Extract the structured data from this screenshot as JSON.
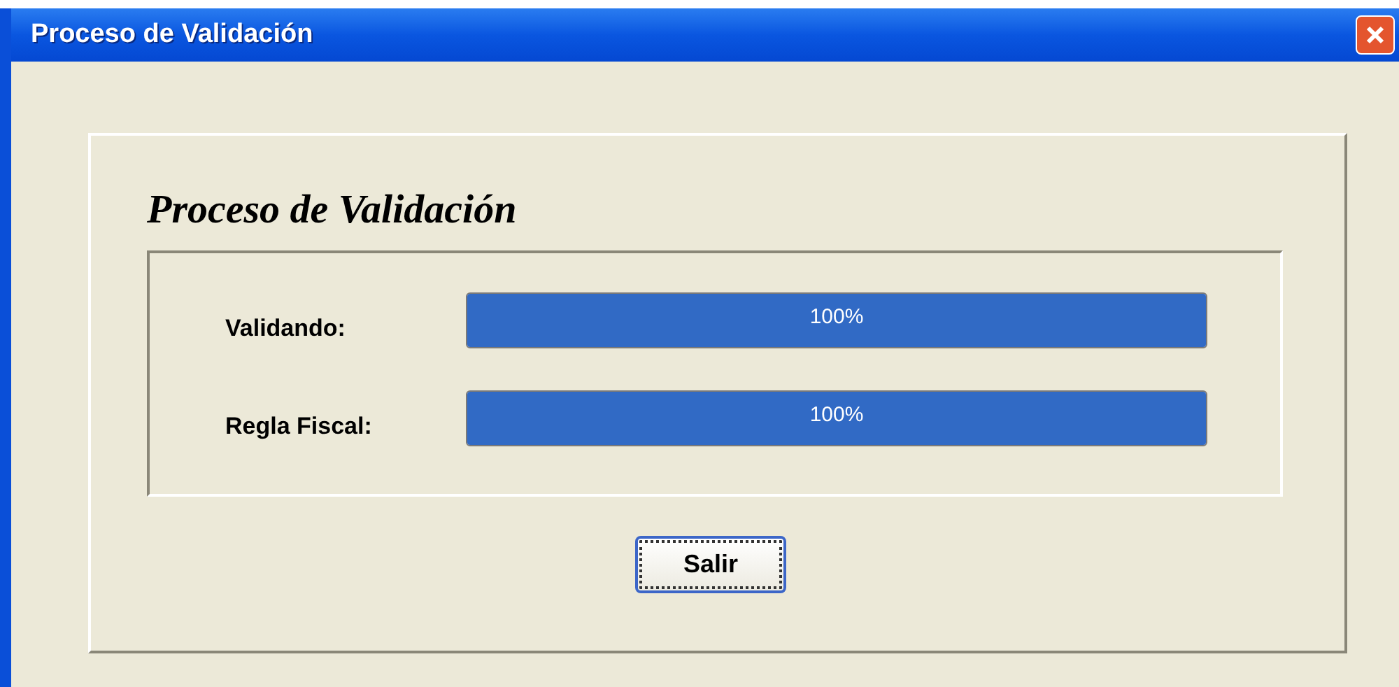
{
  "window": {
    "title": "Proceso de Validación"
  },
  "heading": "Proceso de Validación",
  "progress": [
    {
      "label": "Validando:",
      "level": 1,
      "reading": "100%"
    },
    {
      "label": "Regla Fiscal:",
      "level": 1,
      "reading": "100%"
    }
  ],
  "buttons": [
    {
      "label": "Salir",
      "focused": true
    }
  ]
}
